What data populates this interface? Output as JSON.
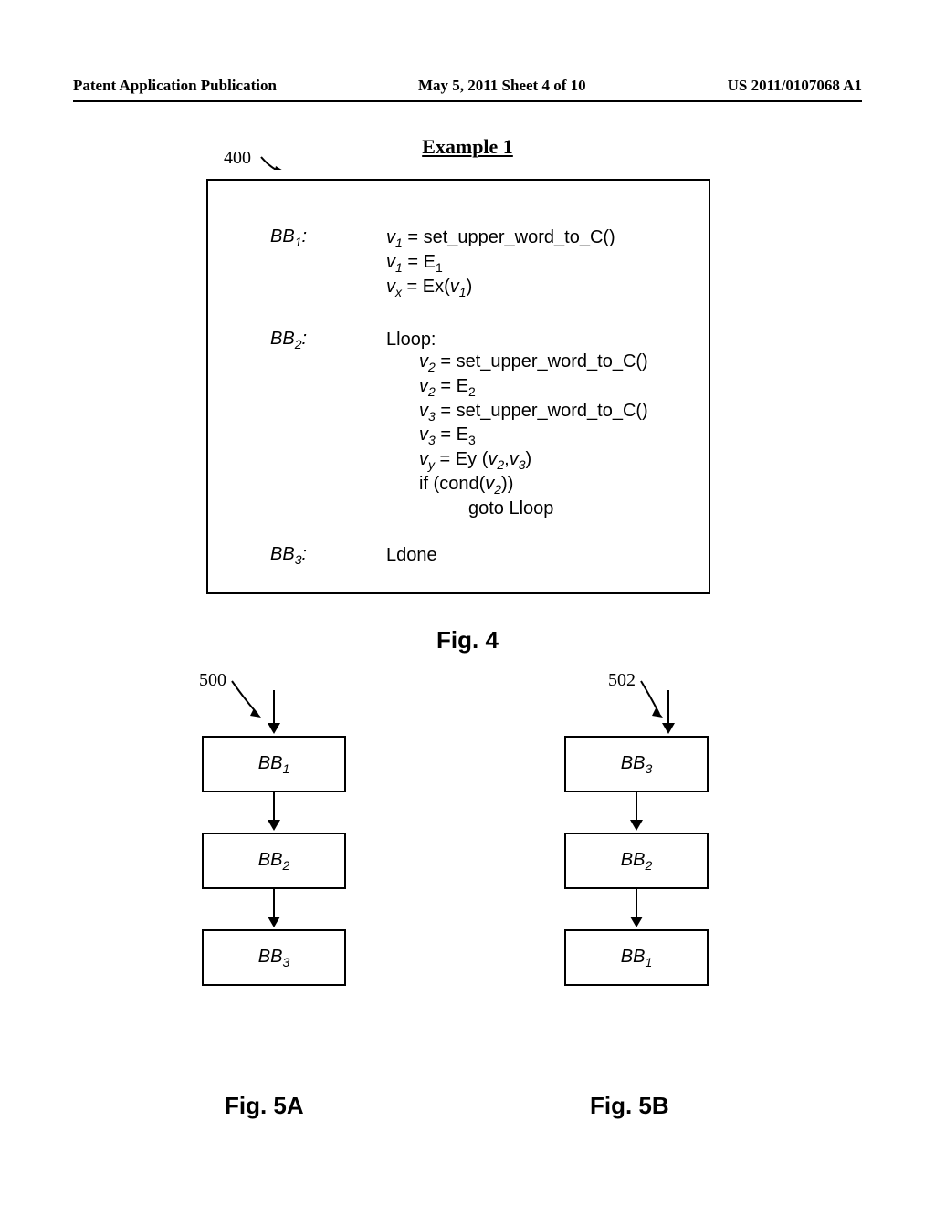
{
  "header": {
    "left": "Patent Application Publication",
    "center": "May 5, 2011  Sheet 4 of 10",
    "right": "US 2011/0107068 A1"
  },
  "example": {
    "title": "Example 1",
    "ref400": "400",
    "blocks": {
      "bb1": {
        "label": "BB",
        "sub": "1"
      },
      "bb2": {
        "label": "BB",
        "sub": "2"
      },
      "bb3": {
        "label": "BB",
        "sub": "3"
      }
    },
    "code": {
      "bb1_l1a": "v",
      "bb1_l1sub": "1",
      "bb1_l1b": " = set_upper_word_to_C()",
      "bb1_l2a": "v",
      "bb1_l2sub": "1",
      "bb1_l2b": " = E",
      "bb1_l2sub2": "1",
      "bb1_l3a": "v",
      "bb1_l3sub": "x",
      "bb1_l3b": " = Ex(",
      "bb1_l3c": "v",
      "bb1_l3sub2": "1",
      "bb1_l3d": ")",
      "bb2_l1": "Lloop:",
      "bb2_l2a": "v",
      "bb2_l2sub": "2",
      "bb2_l2b": " = set_upper_word_to_C()",
      "bb2_l3a": "v",
      "bb2_l3sub": "2",
      "bb2_l3b": " = E",
      "bb2_l3sub2": "2",
      "bb2_l4a": "v",
      "bb2_l4sub": "3",
      "bb2_l4b": " = set_upper_word_to_C()",
      "bb2_l5a": "v",
      "bb2_l5sub": "3",
      "bb2_l5b": " = E",
      "bb2_l5sub2": "3",
      "bb2_l6a": "v",
      "bb2_l6sub": "y",
      "bb2_l6b": " = Ey (",
      "bb2_l6c": "v",
      "bb2_l6sub2": "2",
      "bb2_l6d": ",",
      "bb2_l6e": "v",
      "bb2_l6sub3": "3",
      "bb2_l6f": ")",
      "bb2_l7a": "if (cond(",
      "bb2_l7b": "v",
      "bb2_l7sub": "2",
      "bb2_l7c": "))",
      "bb2_l8": "goto Lloop",
      "bb3_l1": "Ldone"
    }
  },
  "fig4": "Fig. 4",
  "flow": {
    "ref500": "500",
    "ref502": "502",
    "left": [
      {
        "label": "BB",
        "sub": "1"
      },
      {
        "label": "BB",
        "sub": "2"
      },
      {
        "label": "BB",
        "sub": "3"
      }
    ],
    "right": [
      {
        "label": "BB",
        "sub": "3"
      },
      {
        "label": "BB",
        "sub": "2"
      },
      {
        "label": "BB",
        "sub": "1"
      }
    ]
  },
  "fig5a": "Fig. 5A",
  "fig5b": "Fig. 5B"
}
